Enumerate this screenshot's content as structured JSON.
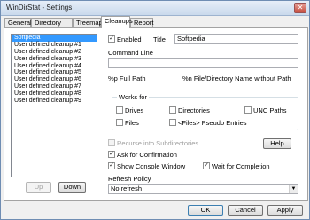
{
  "window": {
    "title": "WinDirStat - Settings",
    "close_glyph": "✕"
  },
  "tabs": [
    {
      "label": "General"
    },
    {
      "label": "Directory List"
    },
    {
      "label": "Treemap"
    },
    {
      "label": "Cleanups"
    },
    {
      "label": "Report"
    }
  ],
  "active_tab": "Cleanups",
  "cleanups": [
    "Softpedia",
    "User defined cleanup #1",
    "User defined cleanup #2",
    "User defined cleanup #3",
    "User defined cleanup #4",
    "User defined cleanup #5",
    "User defined cleanup #6",
    "User defined cleanup #7",
    "User defined cleanup #8",
    "User defined cleanup #9"
  ],
  "selected_cleanup": "Softpedia",
  "list_buttons": {
    "up": "Up",
    "down": "Down"
  },
  "enabled": {
    "label": "Enabled",
    "checked": true
  },
  "title_field": {
    "label": "Title",
    "value": "Softpedia"
  },
  "command_line": {
    "label": "Command Line",
    "value": ""
  },
  "placeholders": {
    "full_path": "%p Full Path",
    "name_without_path": "%n File/Directory Name without Path"
  },
  "works_for": {
    "title": "Works for",
    "options": {
      "drives": {
        "label": "Drives",
        "checked": false
      },
      "directories": {
        "label": "Directories",
        "checked": false
      },
      "unc_paths": {
        "label": "UNC Paths",
        "checked": false
      },
      "files": {
        "label": "Files",
        "checked": false
      },
      "pseudo_entries": {
        "label": "<Files> Pseudo Entries",
        "checked": false
      }
    }
  },
  "recurse": {
    "label": "Recurse into Subdirectories",
    "checked": false,
    "disabled": true
  },
  "help_button": "Help",
  "ask_confirmation": {
    "label": "Ask for Confirmation",
    "checked": true
  },
  "show_console": {
    "label": "Show Console Window",
    "checked": true
  },
  "wait_completion": {
    "label": "Wait for Completion",
    "checked": true
  },
  "refresh_policy": {
    "label": "Refresh Policy",
    "selected": "No refresh"
  },
  "dialog_buttons": {
    "ok": "OK",
    "cancel": "Cancel",
    "apply": "Apply"
  },
  "check_glyph": "✓",
  "dropdown_glyph": "▼"
}
